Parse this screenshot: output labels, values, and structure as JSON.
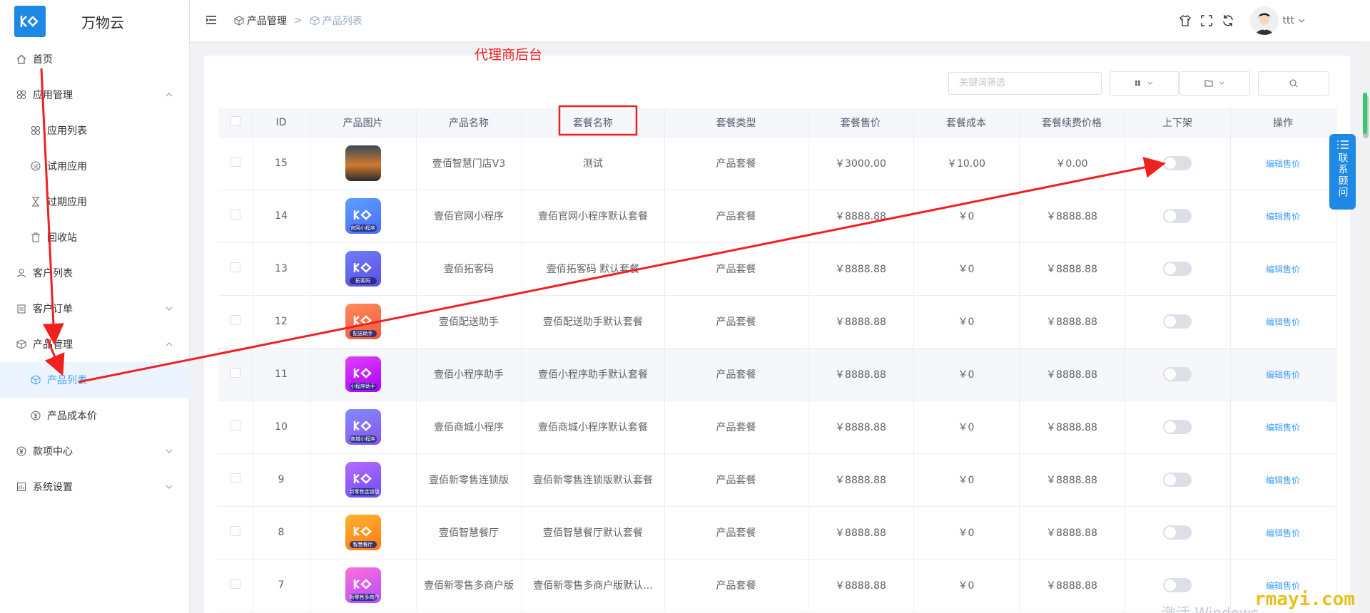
{
  "app": {
    "title": "万物云"
  },
  "sidebar": {
    "items": [
      {
        "label": "首页",
        "icon": "home-icon"
      },
      {
        "label": "应用管理",
        "icon": "apps-icon"
      },
      {
        "label": "应用列表",
        "icon": "apps-icon"
      },
      {
        "label": "试用应用",
        "icon": "trial-icon"
      },
      {
        "label": "过期应用",
        "icon": "hourglass-icon"
      },
      {
        "label": "回收站",
        "icon": "trash-icon"
      },
      {
        "label": "客户列表",
        "icon": "user-icon"
      },
      {
        "label": "客户订单",
        "icon": "clipboard-icon"
      },
      {
        "label": "产品管理",
        "icon": "cube-icon"
      },
      {
        "label": "产品列表",
        "icon": "cube-icon"
      },
      {
        "label": "产品成本价",
        "icon": "yen-icon"
      },
      {
        "label": "款项中心",
        "icon": "yen-icon"
      },
      {
        "label": "系统设置",
        "icon": "settings-icon"
      }
    ]
  },
  "header": {
    "breadcrumb": [
      "产品管理",
      "产品列表"
    ],
    "separator": ">",
    "username": "ttt"
  },
  "annotation": {
    "text": "代理商后台",
    "color": "#f02020"
  },
  "toolbar": {
    "search_placeholder": "关键词筛选"
  },
  "table": {
    "headers": [
      "ID",
      "产品图片",
      "产品名称",
      "套餐名称",
      "套餐类型",
      "套餐售价",
      "套餐成本",
      "套餐续费价格",
      "上下架",
      "操作"
    ],
    "action_label": "编辑售价",
    "rows": [
      {
        "id": "15",
        "image": "sunset",
        "name": "壹佰智慧门店V3",
        "package": "测试",
        "type": "产品套餐",
        "price": "￥3000.00",
        "cost": "￥10.00",
        "renew": "￥0.00",
        "on_shelf": false
      },
      {
        "id": "14",
        "image": "官网小程序",
        "name": "壹佰官网小程序",
        "package": "壹佰官网小程序默认套餐",
        "type": "产品套餐",
        "price": "￥8888.88",
        "cost": "￥0",
        "renew": "￥8888.88",
        "on_shelf": false
      },
      {
        "id": "13",
        "image": "拓客码",
        "name": "壹佰拓客码",
        "package": "壹佰拓客码 默认套餐",
        "type": "产品套餐",
        "price": "￥8888.88",
        "cost": "￥0",
        "renew": "￥8888.88",
        "on_shelf": false
      },
      {
        "id": "12",
        "image": "配送助手",
        "name": "壹佰配送助手",
        "package": "壹佰配送助手默认套餐",
        "type": "产品套餐",
        "price": "￥8888.88",
        "cost": "￥0",
        "renew": "￥8888.88",
        "on_shelf": false
      },
      {
        "id": "11",
        "image": "小程序助手",
        "name": "壹佰小程序助手",
        "package": "壹佰小程序助手默认套餐",
        "type": "产品套餐",
        "price": "￥8888.88",
        "cost": "￥0",
        "renew": "￥8888.88",
        "on_shelf": false
      },
      {
        "id": "10",
        "image": "商城小程序",
        "name": "壹佰商城小程序",
        "package": "壹佰商城小程序默认套餐",
        "type": "产品套餐",
        "price": "￥8888.88",
        "cost": "￥0",
        "renew": "￥8888.88",
        "on_shelf": false
      },
      {
        "id": "9",
        "image": "新零售连锁版",
        "name": "壹佰新零售连锁版",
        "package": "壹佰新零售连锁版默认套餐",
        "type": "产品套餐",
        "price": "￥8888.88",
        "cost": "￥0",
        "renew": "￥8888.88",
        "on_shelf": false
      },
      {
        "id": "8",
        "image": "智慧餐厅",
        "name": "壹佰智慧餐厅",
        "package": "壹佰智慧餐厅默认套餐",
        "type": "产品套餐",
        "price": "￥8888.88",
        "cost": "￥0",
        "renew": "￥8888.88",
        "on_shelf": false
      },
      {
        "id": "7",
        "image": "新零售多商户",
        "name": "壹佰新零售多商户版",
        "package": "壹佰新零售多商户版默认...",
        "type": "产品套餐",
        "price": "￥8888.88",
        "cost": "￥0",
        "renew": "￥8888.88",
        "on_shelf": false
      }
    ]
  },
  "consult": {
    "label": "联系顾问"
  },
  "watermark": "rmayi.com",
  "os_watermark": "激活 Windows",
  "colors": {
    "accent": "#409eff",
    "brand": "#1e88e5",
    "annotation": "#f02020"
  }
}
